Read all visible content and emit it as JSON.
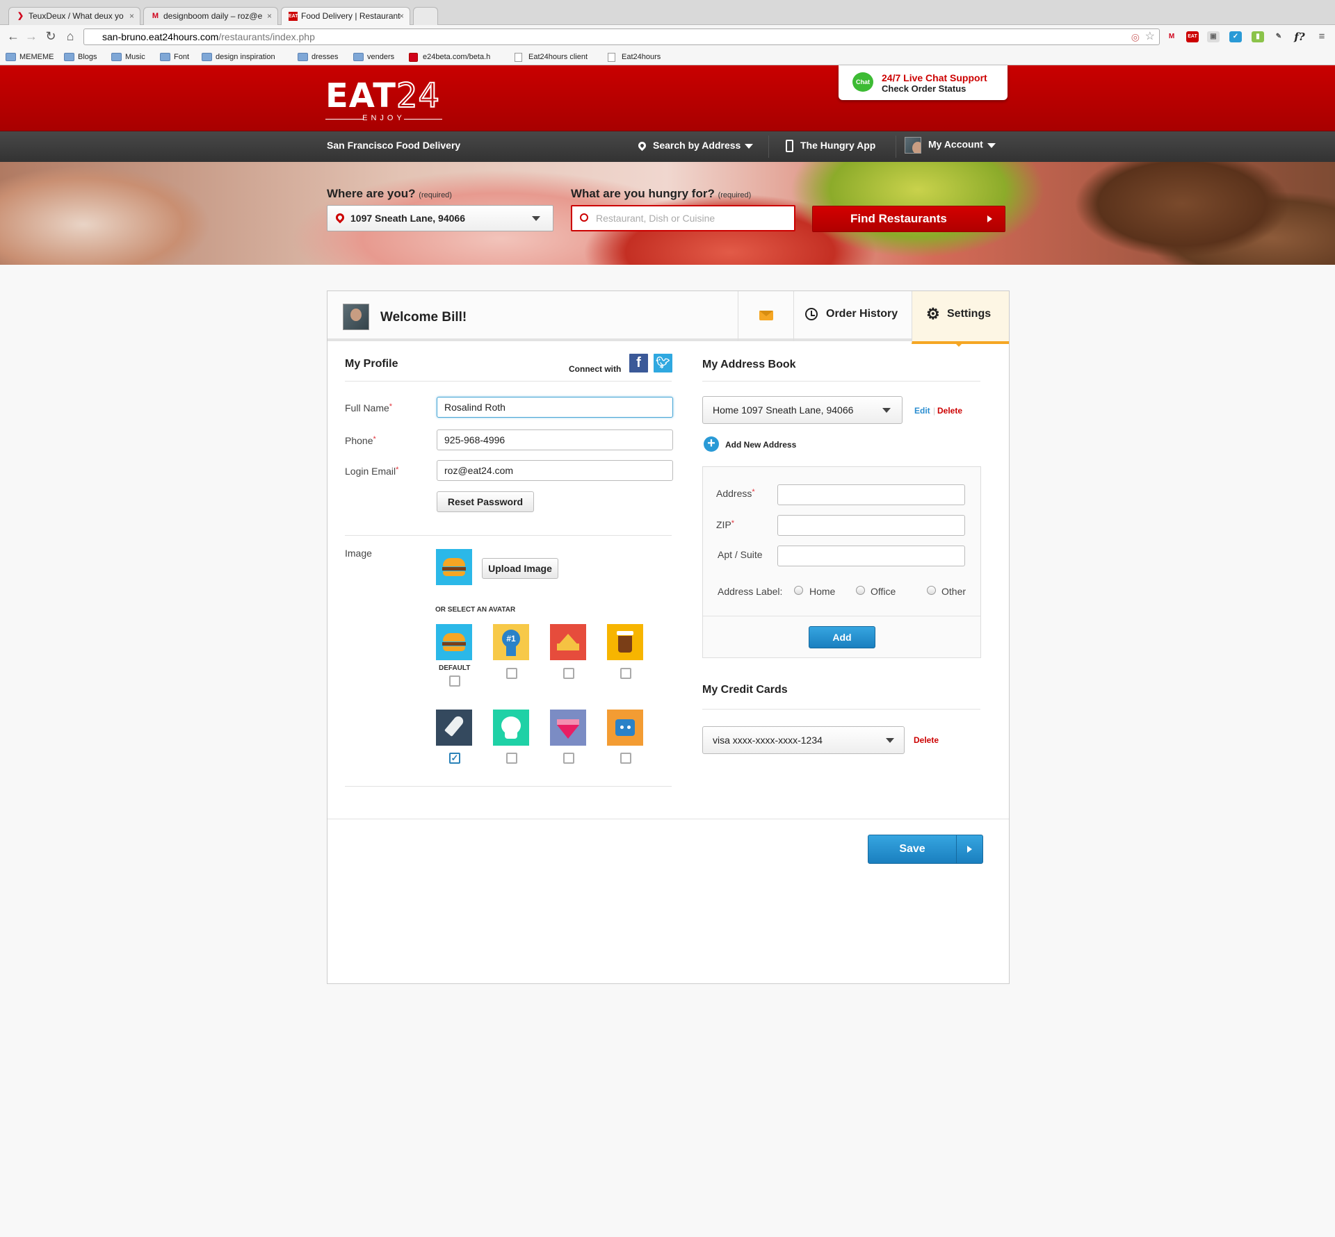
{
  "browser": {
    "tabs": [
      {
        "title": "TeuxDeux / What deux yo",
        "favicon": "teuxdeux-icon"
      },
      {
        "title": "designboom daily – roz@e",
        "favicon": "gmail-icon"
      },
      {
        "title": "Food Delivery | Restaurant",
        "favicon": "eat24-icon"
      }
    ],
    "url_host": "san-bruno.eat24hours.com",
    "url_path": "/restaurants/index.php",
    "bookmarks": [
      "MEMEME",
      "Blogs",
      "Music",
      "Font",
      "design inspiration",
      "dresses",
      "venders",
      "e24beta.com/beta.h",
      "Eat24hours client",
      "Eat24hours"
    ]
  },
  "header": {
    "logo_main": "EAT",
    "logo_num": "24",
    "logo_tagline": "ENJOY",
    "chat_icon_label": "Chat",
    "chat_title": "24/7 Live Chat Support",
    "chat_subtitle": "Check Order Status"
  },
  "navbar": {
    "city": "San Francisco Food Delivery",
    "search_address": "Search by Address",
    "app": "The Hungry App",
    "account": "My Account"
  },
  "search": {
    "where_label": "Where are you?",
    "where_req": "(required)",
    "location_value": "1097 Sneath Lane, 94066",
    "what_label": "What are you hungry for?",
    "what_req": "(required)",
    "food_placeholder": "Restaurant, Dish or Cuisine",
    "find_button": "Find Restaurants"
  },
  "panel": {
    "welcome": "Welcome Bill!",
    "tab_history": "Order History",
    "tab_settings": "Settings"
  },
  "profile": {
    "title": "My Profile",
    "connect": "Connect with",
    "full_name_label": "Full Name",
    "full_name": "Rosalind Roth",
    "phone_label": "Phone",
    "phone": "925-968-4996",
    "email_label": "Login Email",
    "email": "roz@eat24.com",
    "reset": "Reset Password",
    "image_label": "Image",
    "upload": "Upload Image",
    "avatar_heading": "OR SELECT AN AVATAR",
    "default_label": "DEFAULT",
    "avatars": [
      "burger",
      "ribbon",
      "crown",
      "coffee",
      "rocket",
      "skull",
      "diamond",
      "robot"
    ],
    "avatar_ribbon_text": "#1",
    "selected_avatar": "rocket"
  },
  "address_book": {
    "title": "My Address Book",
    "selected": "Home 1097 Sneath Lane, 94066",
    "edit": "Edit",
    "delete": "Delete",
    "add_new": "Add New Address",
    "address_label": "Address",
    "zip_label": "ZIP",
    "apt_label": "Apt / Suite",
    "label_label": "Address Label:",
    "label_options": [
      "Home",
      "Office",
      "Other"
    ],
    "add_button": "Add"
  },
  "credit_cards": {
    "title": "My Credit Cards",
    "selected": "visa xxxx-xxxx-xxxx-1234",
    "delete": "Delete"
  },
  "save_button": "Save",
  "colors": {
    "brand_red": "#c90000",
    "accent_blue": "#2a8dd0",
    "settings_tab": "#f5a623"
  }
}
